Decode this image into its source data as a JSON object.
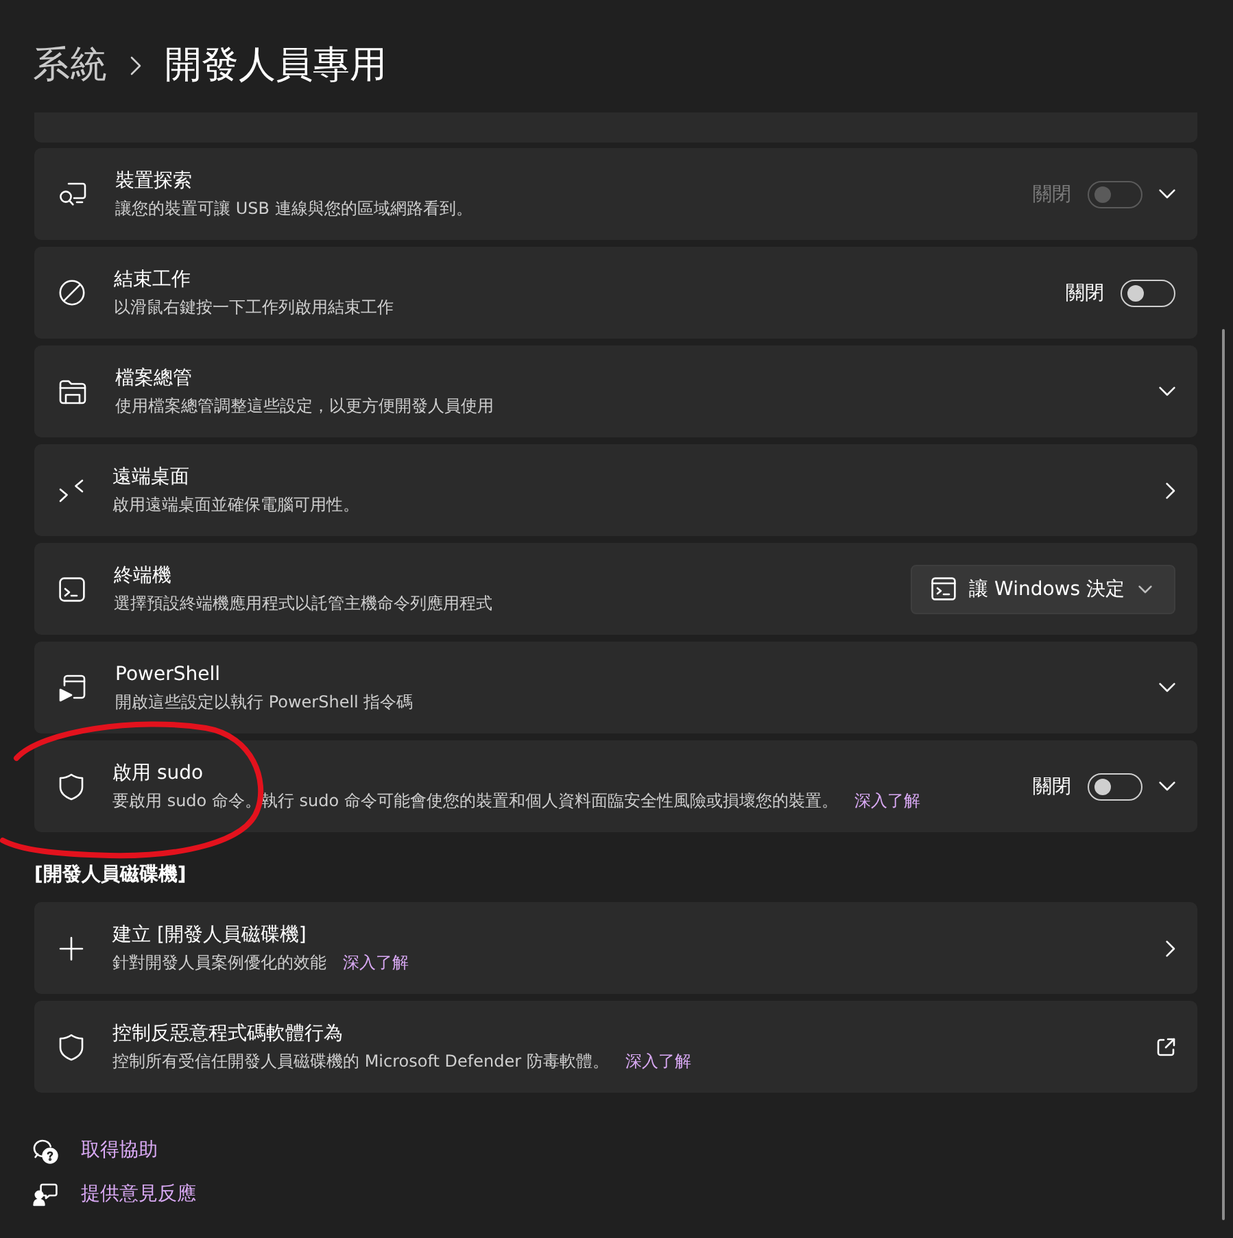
{
  "header": {
    "breadcrumb": [
      {
        "label": "系統",
        "current": false
      },
      {
        "label": "開發人員專用",
        "current": true
      }
    ]
  },
  "sections": [
    {
      "items": [
        {
          "kind": "toggle-expander",
          "title": "裝置探索",
          "description": "讓您的裝置可讓 USB 連線與您的區域網路看到。",
          "toggle": {
            "label": "關閉",
            "on": false,
            "disabled": true
          },
          "annotated": false
        },
        {
          "kind": "toggle",
          "title": "結束工作",
          "description": "以滑鼠右鍵按一下工作列啟用結束工作",
          "toggle": {
            "label": "關閉",
            "on": false,
            "disabled": false
          },
          "annotated": false
        },
        {
          "kind": "expander",
          "title": "檔案總管",
          "description": "使用檔案總管調整這些設定，以更方便開發人員使用",
          "annotated": false
        },
        {
          "kind": "link",
          "title": "遠端桌面",
          "description": "啟用遠端桌面並確保電腦可用性。",
          "annotated": false
        },
        {
          "kind": "dropdown",
          "title": "終端機",
          "description": "選擇預設終端機應用程式以託管主機命令列應用程式",
          "dropdown": {
            "value": "讓 Windows 決定"
          },
          "annotated": false
        },
        {
          "kind": "expander",
          "title": "PowerShell",
          "description": "開啟這些設定以執行 PowerShell 指令碼",
          "annotated": false
        },
        {
          "kind": "toggle-expander",
          "title": "啟用 sudo",
          "description": "要啟用 sudo 命令。執行 sudo 命令可能會使您的裝置和個人資料面臨安全性風險或損壞您的裝置。",
          "learn_more": "深入了解",
          "toggle": {
            "label": "關閉",
            "on": false,
            "disabled": false
          },
          "annotated": true
        }
      ]
    },
    {
      "heading": "[開發人員磁碟機]",
      "items": [
        {
          "kind": "link",
          "title": "建立 [開發人員磁碟機]",
          "description": "針對開發人員案例優化的效能",
          "learn_more": "深入了解",
          "annotated": false
        },
        {
          "kind": "external",
          "title": "控制反惡意程式碼軟體行為",
          "description": "控制所有受信任開發人員磁碟機的 Microsoft Defender 防毒軟體。",
          "learn_more": "深入了解",
          "annotated": false
        }
      ]
    }
  ],
  "footer_links": [
    "取得協助",
    "提供意見反應"
  ]
}
